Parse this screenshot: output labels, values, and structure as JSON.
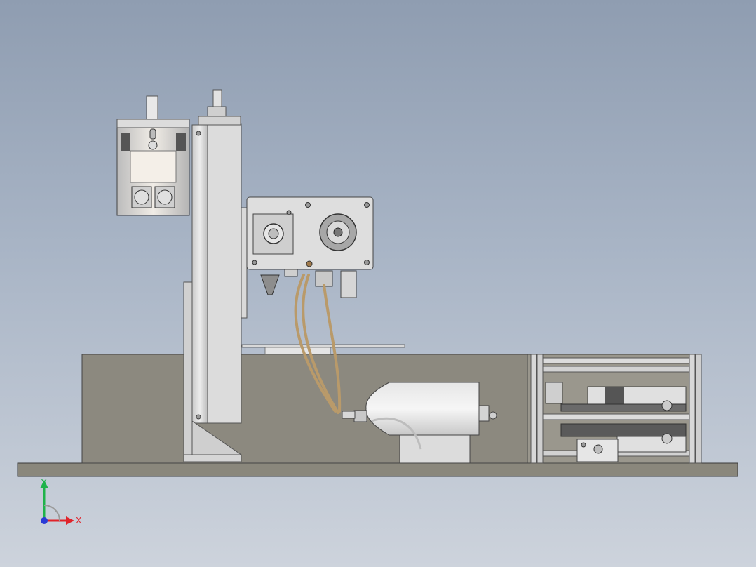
{
  "viewport": {
    "background_top": "#8f9db1",
    "background_bottom": "#cdd3dc"
  },
  "triad": {
    "x_label": "X",
    "y_label": "Y",
    "x_color": "#e0232a",
    "y_color": "#1fb34a",
    "z_color": "#2b3bd6"
  },
  "model": {
    "base_color": "#8a877c",
    "steel_color": "#d4d4d4",
    "tube_color": "#b99a6a"
  }
}
